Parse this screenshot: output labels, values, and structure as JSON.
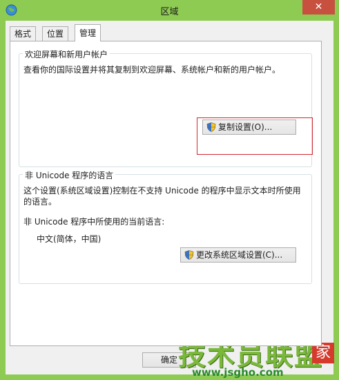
{
  "window": {
    "title": "区域",
    "close_glyph": "✕"
  },
  "tabs": [
    {
      "label": "格式"
    },
    {
      "label": "位置"
    },
    {
      "label": "管理"
    }
  ],
  "welcome_group": {
    "title": "欢迎屏幕和新用户帐户",
    "description": "查看你的国际设置并将其复制到欢迎屏幕、系统帐户和新的用户帐户。",
    "copy_button": "复制设置(O)..."
  },
  "unicode_group": {
    "title": "非 Unicode 程序的语言",
    "description_line1": "这个设置(系统区域设置)控制在不支持 Unicode 的程序中显示文本时所使用",
    "description_line2": "的语言。",
    "current_label": "非 Unicode 程序中所使用的当前语言:",
    "current_value": "中文(简体，中国)",
    "change_button": "更改系统区域设置(C)..."
  },
  "footer": {
    "ok_button": "确定"
  },
  "watermark": {
    "main": "技术员联盟",
    "jia": "家",
    "url": "www.jsgho.com"
  },
  "colors": {
    "frame": "#8ecb52",
    "close": "#c7503f",
    "highlight": "#d2272f"
  }
}
